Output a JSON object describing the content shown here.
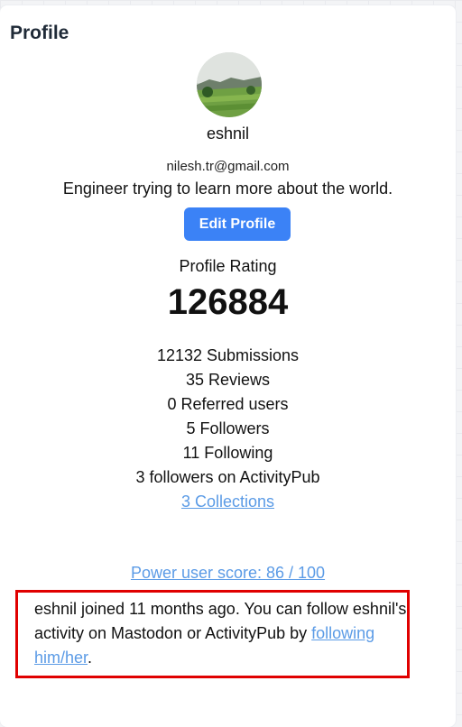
{
  "profile": {
    "heading": "Profile",
    "username": "eshnil",
    "email": "nilesh.tr@gmail.com",
    "bio": "Engineer trying to learn more about the world.",
    "edit_button_label": "Edit Profile",
    "rating_label": "Profile Rating",
    "rating_value": "126884"
  },
  "stats": [
    "12132 Submissions",
    "35 Reviews",
    "0 Referred users",
    "5 Followers",
    "11 Following",
    "3 followers on ActivityPub"
  ],
  "collections_link": "3 Collections",
  "power_score_link": "Power user score: 86 / 100",
  "join_notice": {
    "text": "eshnil joined 11 months ago. You can follow eshnil's activity on Mastodon or ActivityPub by ",
    "link": "following him/her",
    "suffix": "."
  },
  "colors": {
    "accent": "#3b82f6",
    "link": "#5b9be6",
    "highlight_border": "#e00000"
  }
}
